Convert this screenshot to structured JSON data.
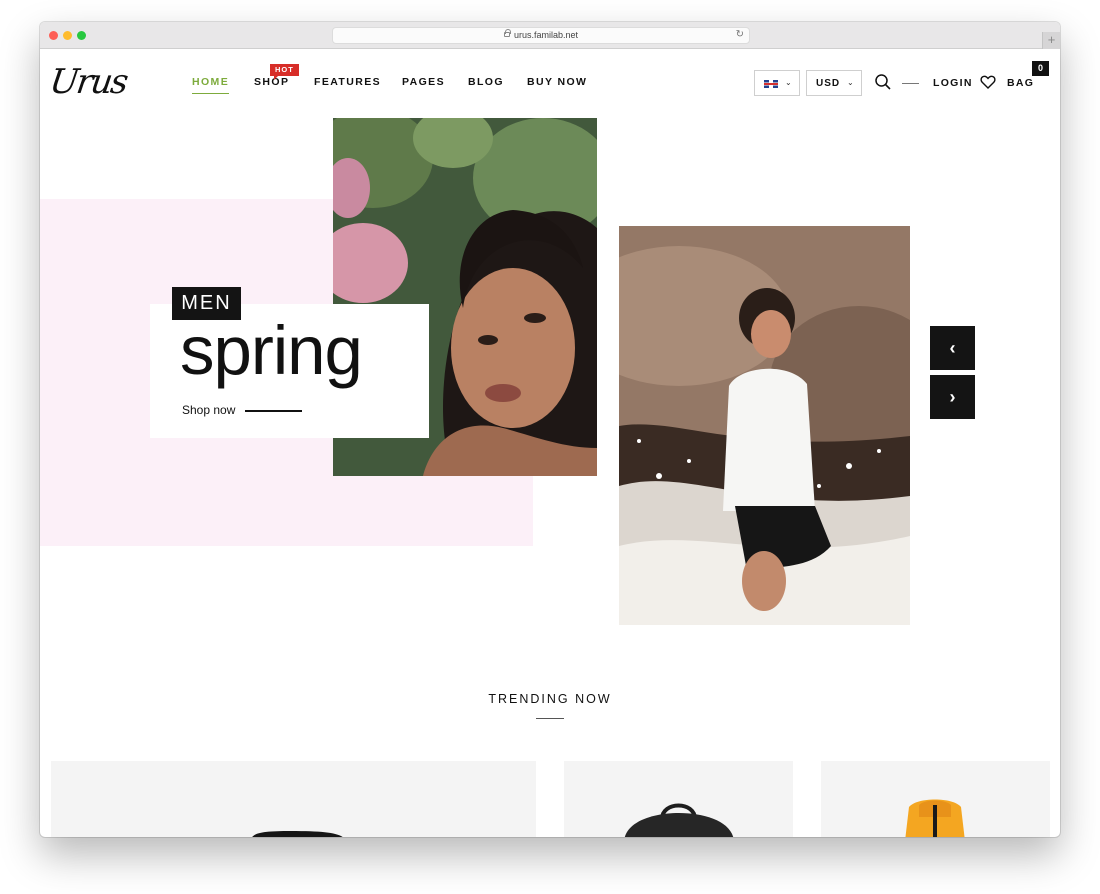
{
  "browser": {
    "url": "urus.familab.net",
    "reload_glyph": "↻",
    "newtab_glyph": "+"
  },
  "header": {
    "logo": "Urus",
    "nav": [
      {
        "label": "HOME",
        "active": true
      },
      {
        "label": "SHOP",
        "active": false
      },
      {
        "label": "FEATURES",
        "active": false
      },
      {
        "label": "PAGES",
        "active": false
      },
      {
        "label": "BLOG",
        "active": false
      },
      {
        "label": "BUY NOW",
        "active": false
      }
    ],
    "shop_badge": "HOT",
    "language_flag": "uk-flag-icon",
    "currency": "USD",
    "caret_glyph": "⌄",
    "login": "LOGIN",
    "bag": "BAG",
    "bag_count": "0"
  },
  "hero": {
    "tag": "MEN",
    "headline": "spring",
    "cta": "Shop now",
    "prev_glyph": "‹",
    "next_glyph": "›"
  },
  "trending": {
    "title": "TRENDING NOW"
  },
  "colors": {
    "accent": "#7dab3c",
    "badge": "#d72d28",
    "pink": "#fcf0f8",
    "dark": "#141414"
  }
}
